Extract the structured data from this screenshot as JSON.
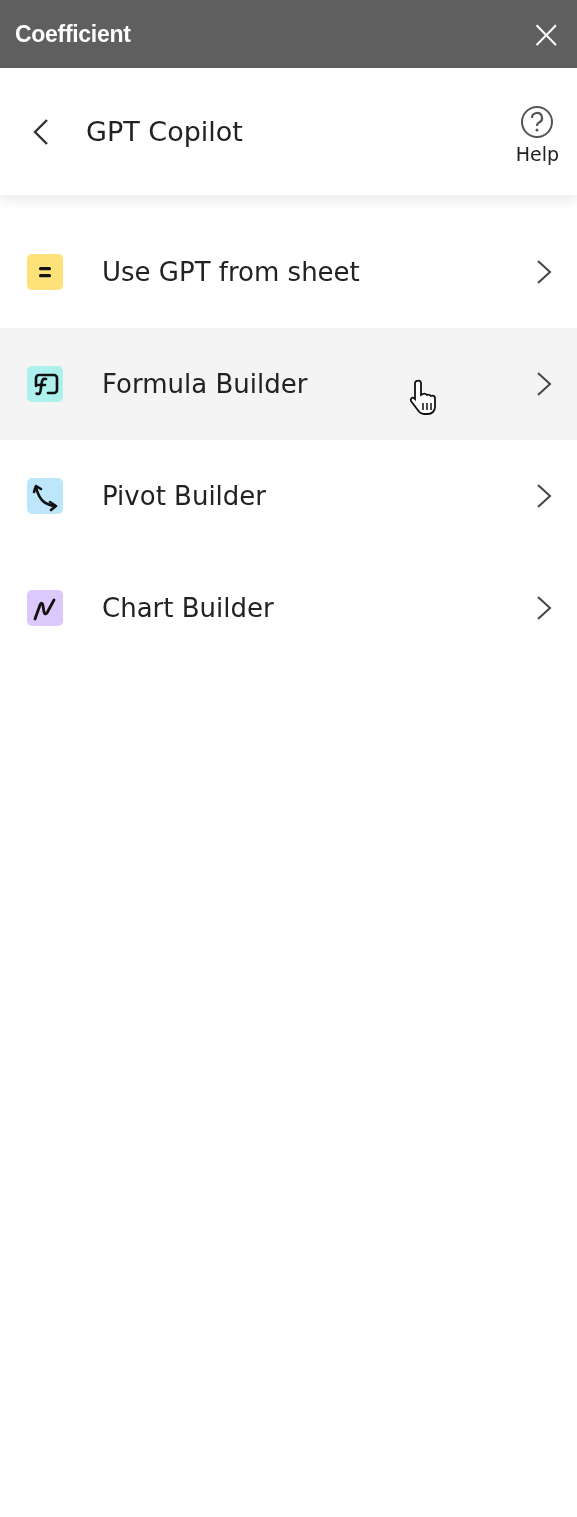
{
  "window": {
    "title": "Coefficient",
    "close": "×"
  },
  "header": {
    "title": "GPT Copilot",
    "help": "Help"
  },
  "items": [
    {
      "label": "Use GPT from sheet",
      "kind": "equals",
      "color": "#ffe17a",
      "hovered": false
    },
    {
      "label": "Formula Builder",
      "kind": "formula",
      "color": "#aef0ee",
      "hovered": true
    },
    {
      "label": "Pivot Builder",
      "kind": "pivot",
      "color": "#bde6fb",
      "hovered": false
    },
    {
      "label": "Chart Builder",
      "kind": "chart",
      "color": "#dcc8fb",
      "hovered": false
    }
  ]
}
